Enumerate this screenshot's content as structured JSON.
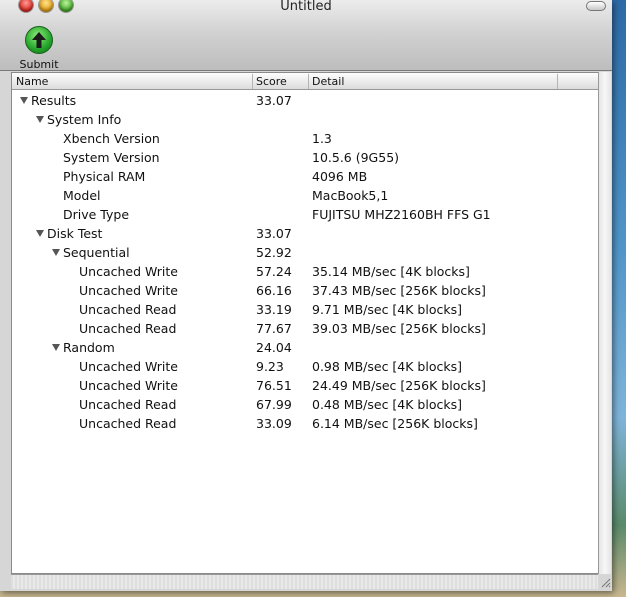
{
  "window": {
    "title": "Untitled"
  },
  "toolbar": {
    "submit_label": "Submit"
  },
  "table": {
    "columns": {
      "name": "Name",
      "score": "Score",
      "detail": "Detail"
    },
    "rows": [
      {
        "name": "Results",
        "score": "33.07",
        "detail": "",
        "level": 0,
        "expanded": true
      },
      {
        "name": "System Info",
        "score": "",
        "detail": "",
        "level": 1,
        "expanded": true
      },
      {
        "name": "Xbench Version",
        "score": "",
        "detail": "1.3",
        "level": 2
      },
      {
        "name": "System Version",
        "score": "",
        "detail": "10.5.6 (9G55)",
        "level": 2
      },
      {
        "name": "Physical RAM",
        "score": "",
        "detail": "4096 MB",
        "level": 2
      },
      {
        "name": "Model",
        "score": "",
        "detail": "MacBook5,1",
        "level": 2
      },
      {
        "name": "Drive Type",
        "score": "",
        "detail": "FUJITSU MHZ2160BH FFS G1",
        "level": 2
      },
      {
        "name": "Disk Test",
        "score": "33.07",
        "detail": "",
        "level": 1,
        "expanded": true
      },
      {
        "name": "Sequential",
        "score": "52.92",
        "detail": "",
        "level": 2,
        "expanded": true
      },
      {
        "name": "Uncached Write",
        "score": "57.24",
        "detail": "35.14 MB/sec [4K blocks]",
        "level": 3
      },
      {
        "name": "Uncached Write",
        "score": "66.16",
        "detail": "37.43 MB/sec [256K blocks]",
        "level": 3
      },
      {
        "name": "Uncached Read",
        "score": "33.19",
        "detail": "9.71 MB/sec [4K blocks]",
        "level": 3
      },
      {
        "name": "Uncached Read",
        "score": "77.67",
        "detail": "39.03 MB/sec [256K blocks]",
        "level": 3
      },
      {
        "name": "Random",
        "score": "24.04",
        "detail": "",
        "level": 2,
        "expanded": true
      },
      {
        "name": "Uncached Write",
        "score": "9.23",
        "detail": "0.98 MB/sec [4K blocks]",
        "level": 3
      },
      {
        "name": "Uncached Write",
        "score": "76.51",
        "detail": "24.49 MB/sec [256K blocks]",
        "level": 3
      },
      {
        "name": "Uncached Read",
        "score": "67.99",
        "detail": "0.48 MB/sec [4K blocks]",
        "level": 3
      },
      {
        "name": "Uncached Read",
        "score": "33.09",
        "detail": "6.14 MB/sec [256K blocks]",
        "level": 3
      }
    ]
  }
}
